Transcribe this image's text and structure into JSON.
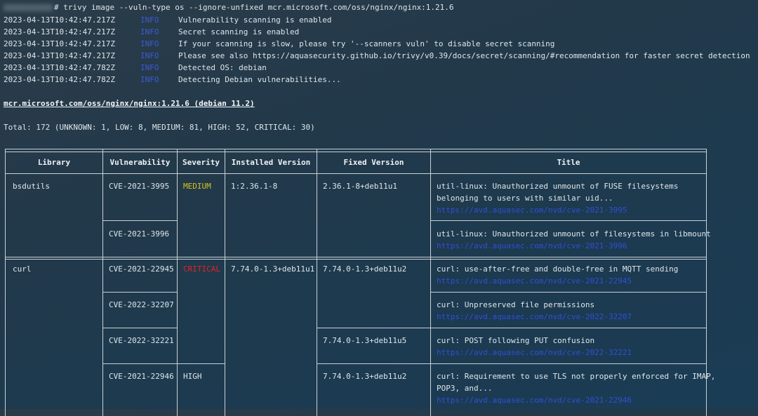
{
  "command": {
    "prompt_suffix": "# ",
    "text": "trivy image --vuln-type os --ignore-unfixed mcr.microsoft.com/oss/nginx/nginx:1.21.6"
  },
  "logs": [
    {
      "time": "2023-04-13T10:42:47.217Z",
      "level": "INFO",
      "msg": "Vulnerability scanning is enabled"
    },
    {
      "time": "2023-04-13T10:42:47.217Z",
      "level": "INFO",
      "msg": "Secret scanning is enabled"
    },
    {
      "time": "2023-04-13T10:42:47.217Z",
      "level": "INFO",
      "msg": "If your scanning is slow, please try '--scanners vuln' to disable secret scanning"
    },
    {
      "time": "2023-04-13T10:42:47.217Z",
      "level": "INFO",
      "msg": "Please see also https://aquasecurity.github.io/trivy/v0.39/docs/secret/scanning/#recommendation for faster secret detection"
    },
    {
      "time": "2023-04-13T10:42:47.782Z",
      "level": "INFO",
      "msg": "Detected OS: debian"
    },
    {
      "time": "2023-04-13T10:42:47.782Z",
      "level": "INFO",
      "msg": "Detecting Debian vulnerabilities..."
    }
  ],
  "target": "mcr.microsoft.com/oss/nginx/nginx:1.21.6 (debian 11.2)",
  "total": "Total: 172 (UNKNOWN: 1, LOW: 8, MEDIUM: 81, HIGH: 52, CRITICAL: 30)",
  "headers": [
    "Library",
    "Vulnerability",
    "Severity",
    "Installed Version",
    "Fixed Version",
    "Title"
  ],
  "rows": {
    "r1": {
      "library": "bsdutils",
      "vuln": "CVE-2021-3995",
      "severity": "MEDIUM",
      "installed": "1:2.36.1-8",
      "fixed": "2.36.1-8+deb11u1",
      "title1": "util-linux: Unauthorized unmount of FUSE filesystems",
      "title2": "belonging to users with similar uid...",
      "link": "https://avd.aquasec.com/nvd/cve-2021-3995"
    },
    "r2": {
      "vuln": "CVE-2021-3996",
      "title1": "util-linux: Unauthorized unmount of filesystems in libmount",
      "link": "https://avd.aquasec.com/nvd/cve-2021-3996"
    },
    "r3": {
      "library": "curl",
      "vuln": "CVE-2021-22945",
      "severity": "CRITICAL",
      "installed": "7.74.0-1.3+deb11u1",
      "fixed": "7.74.0-1.3+deb11u2",
      "title1": "curl: use-after-free and double-free in MQTT sending",
      "link": "https://avd.aquasec.com/nvd/cve-2021-22945"
    },
    "r4": {
      "vuln": "CVE-2022-32207",
      "title1": "curl: Unpreserved file permissions",
      "link": "https://avd.aquasec.com/nvd/cve-2022-32207"
    },
    "r5": {
      "vuln": "CVE-2022-32221",
      "fixed": "7.74.0-1.3+deb11u5",
      "title1": "curl: POST following PUT confusion",
      "link": "https://avd.aquasec.com/nvd/cve-2022-32221"
    },
    "r6": {
      "vuln": "CVE-2021-22946",
      "severity": "HIGH",
      "fixed": "7.74.0-1.3+deb11u2",
      "title1": "curl: Requirement to use TLS not properly enforced for IMAP,",
      "title2": "POP3, and...",
      "link": "https://avd.aquasec.com/nvd/cve-2021-22946"
    }
  },
  "colors": {
    "info": "#3a5bd6",
    "medium": "#d9c21a",
    "critical": "#e02424",
    "link": "#2f4fd8"
  }
}
